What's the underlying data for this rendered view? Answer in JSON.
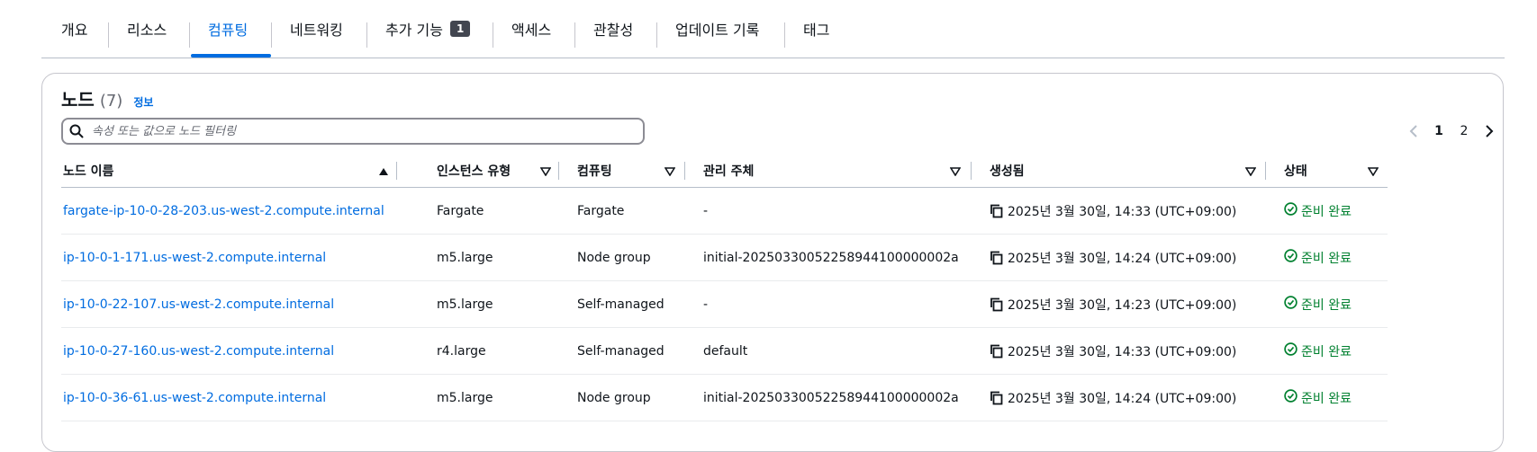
{
  "tabs": [
    {
      "label": "개요"
    },
    {
      "label": "리소스"
    },
    {
      "label": "컴퓨팅",
      "active": true
    },
    {
      "label": "네트워킹"
    },
    {
      "label": "추가 기능",
      "badge": "1"
    },
    {
      "label": "액세스"
    },
    {
      "label": "관찰성"
    },
    {
      "label": "업데이트 기록"
    },
    {
      "label": "태그"
    }
  ],
  "nodes_panel": {
    "title": "노드",
    "count": "(7)",
    "info_link": "정보",
    "search_placeholder": "속성 또는 값으로 노드 필터링",
    "pagination": {
      "pages": [
        "1",
        "2"
      ],
      "current": "1"
    }
  },
  "table": {
    "columns": [
      "노드 이름",
      "인스턴스 유형",
      "컴퓨팅",
      "관리 주체",
      "생성됨",
      "상태"
    ],
    "rows": [
      {
        "name": "fargate-ip-10-0-28-203.us-west-2.compute.internal",
        "instance_type": "Fargate",
        "compute": "Fargate",
        "managed_by": "-",
        "created": "2025년 3월 30일, 14:33 (UTC+09:00)",
        "status": "준비 완료"
      },
      {
        "name": "ip-10-0-1-171.us-west-2.compute.internal",
        "instance_type": "m5.large",
        "compute": "Node group",
        "managed_by": "initial-20250330052258944100000002a",
        "created": "2025년 3월 30일, 14:24 (UTC+09:00)",
        "status": "준비 완료"
      },
      {
        "name": "ip-10-0-22-107.us-west-2.compute.internal",
        "instance_type": "m5.large",
        "compute": "Self-managed",
        "managed_by": "-",
        "created": "2025년 3월 30일, 14:23 (UTC+09:00)",
        "status": "준비 완료"
      },
      {
        "name": "ip-10-0-27-160.us-west-2.compute.internal",
        "instance_type": "r4.large",
        "compute": "Self-managed",
        "managed_by": "default",
        "created": "2025년 3월 30일, 14:33 (UTC+09:00)",
        "status": "준비 완료"
      },
      {
        "name": "ip-10-0-36-61.us-west-2.compute.internal",
        "instance_type": "m5.large",
        "compute": "Node group",
        "managed_by": "initial-20250330052258944100000002a",
        "created": "2025년 3월 30일, 14:24 (UTC+09:00)",
        "status": "준비 완료"
      }
    ]
  },
  "colors": {
    "link": "#006ce0",
    "status_ok": "#00802f",
    "border": "#b6bec9",
    "text": "#0f141a"
  }
}
